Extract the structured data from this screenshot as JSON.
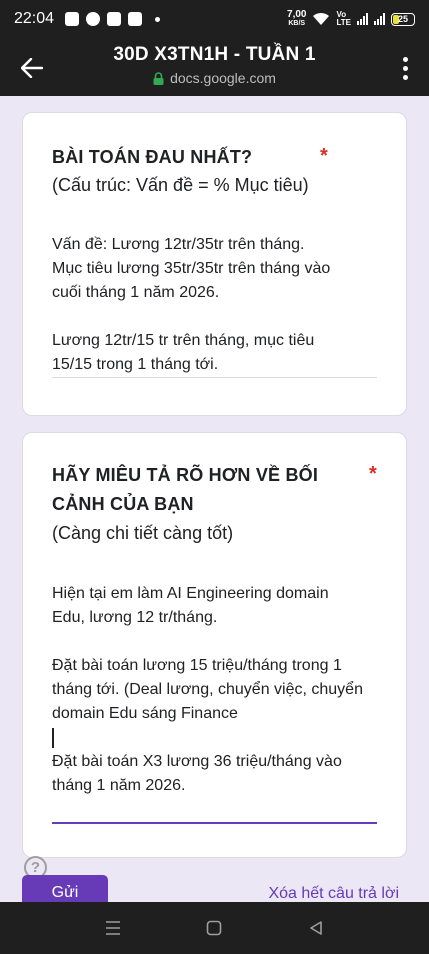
{
  "status_bar": {
    "time": "22:04",
    "net_speed_value": "7,00",
    "net_speed_unit": "KB/S",
    "volte_top": "Vo",
    "volte_bottom": "LTE",
    "battery": "25"
  },
  "app_bar": {
    "title": "30D X3TN1H - TUẦN 1",
    "url": "docs.google.com"
  },
  "questions": [
    {
      "title": "BÀI TOÁN ĐAU NHẤT?",
      "required_mark": "*",
      "description": "(Cấu trúc: Vấn đề = % Mục tiêu)",
      "answer": "Vấn đề: Lương 12tr/35tr trên tháng.\nMục tiêu lương 35tr/35tr trên tháng vào\ncuối tháng 1 năm 2026.\n\nLương 12tr/15 tr trên tháng, mục tiêu\n15/15 trong 1 tháng tới."
    },
    {
      "title": "HÃY MIÊU TẢ RÕ HƠN VỀ BỐI CẢNH CỦA BẠN",
      "required_mark": "*",
      "description": "(Càng chi tiết càng tốt)",
      "answer": "Hiện tại em làm AI Engineering domain\nEdu, lương 12 tr/tháng.\n\nĐặt bài toán lương 15 triệu/tháng trong 1\ntháng tới. (Deal lương, chuyển việc, chuyển\ndomain Edu sáng Finance\n\nĐặt bài toán X3 lương 36 triệu/tháng vào\ntháng 1 năm 2026."
    }
  ],
  "actions": {
    "help": "?",
    "submit": "Gửi",
    "clear": "Xóa hết câu trả lời"
  },
  "colors": {
    "accent": "#673ab7",
    "required": "#d93025",
    "background": "#ece7f4",
    "bars": "#1f1f1f"
  },
  "icons": [
    "back-arrow-icon",
    "lock-icon",
    "more-vert-icon",
    "help-icon",
    "recent-apps-icon",
    "home-icon",
    "back-nav-icon"
  ]
}
